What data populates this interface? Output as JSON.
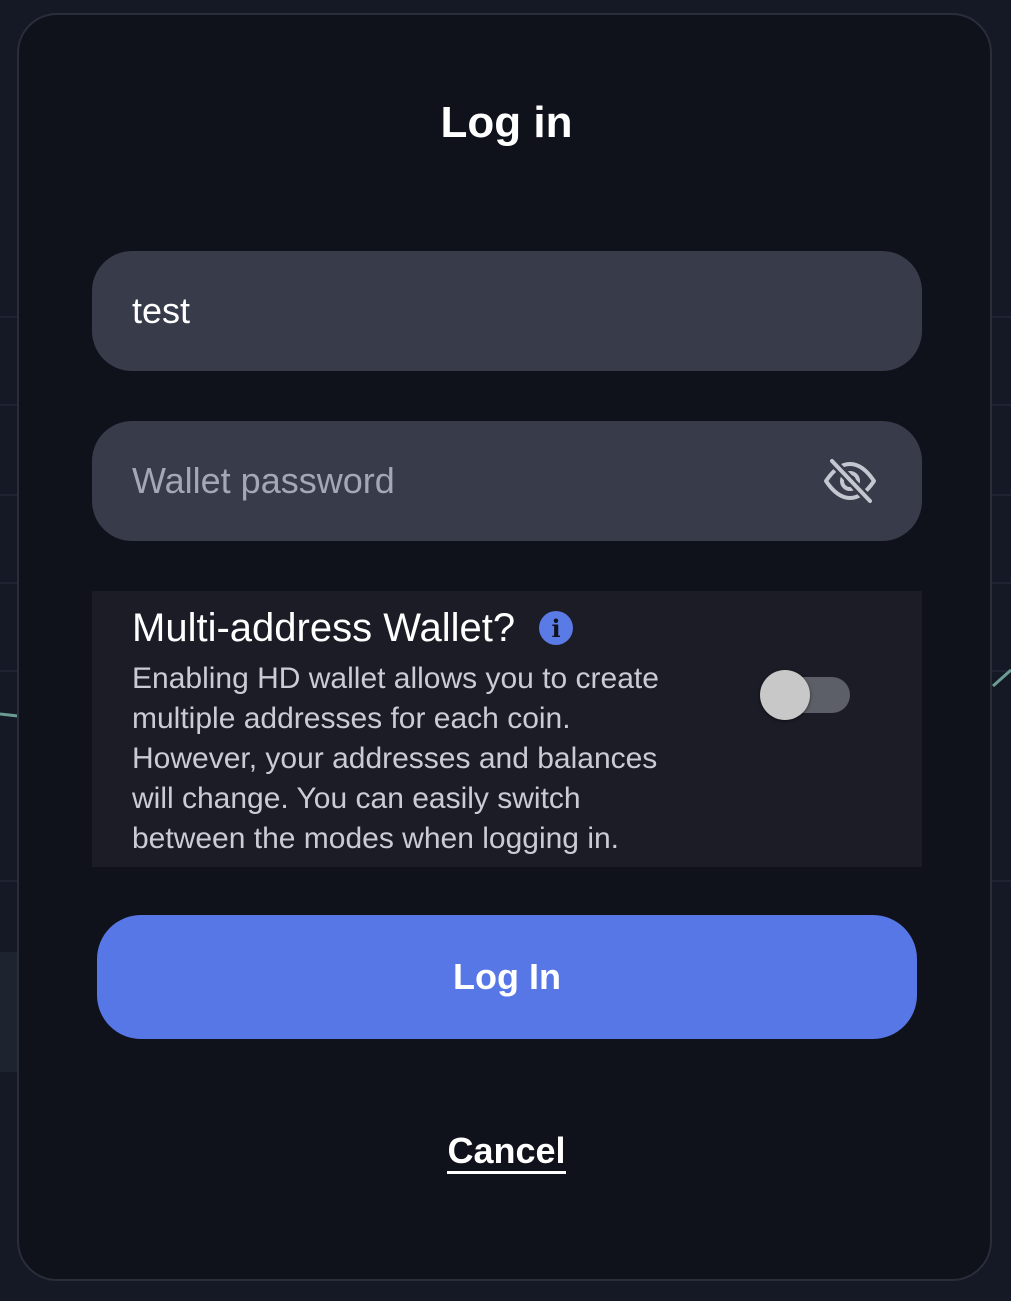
{
  "modal": {
    "title": "Log in"
  },
  "username_field": {
    "value": "test"
  },
  "password_field": {
    "placeholder": "Wallet password",
    "visibility_icon": "eye-slash-icon"
  },
  "hd_wallet": {
    "title": "Multi-address Wallet?",
    "info_icon": "info-icon",
    "info_glyph": "i",
    "description": "Enabling HD wallet allows you to create multiple addresses for each coin. However, your addresses and balances will change. You can easily switch between the modes when logging in.",
    "toggle_on": false
  },
  "actions": {
    "login_label": "Log In",
    "cancel_label": "Cancel"
  },
  "colors": {
    "accent": "#5877e6",
    "modal_background": "#10121b",
    "field_background": "#373b4a",
    "panel_background": "#1b1c26"
  }
}
